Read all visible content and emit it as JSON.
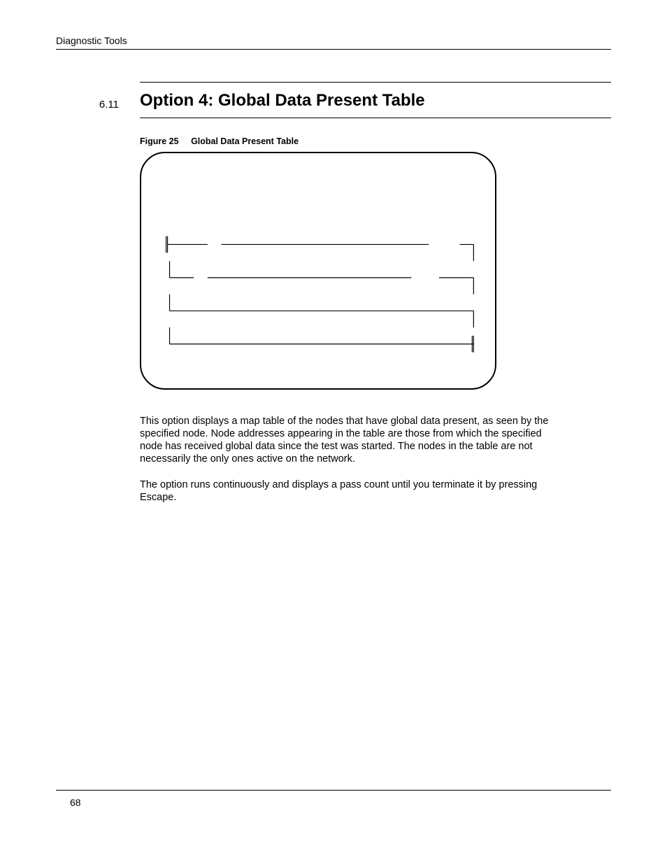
{
  "header": {
    "title": "Diagnostic Tools"
  },
  "section": {
    "number": "6.11",
    "heading": "Option 4:  Global Data Present Table"
  },
  "figure": {
    "label": "Figure 25",
    "title": "Global Data Present Table"
  },
  "body": {
    "p1": "This option displays a map table of the nodes that have global data present, as seen by the specified node.  Node addresses appearing in the table are those from which the specified node has received global data since the test was started. The nodes in the table are not necessarily the only ones active on the network.",
    "p2": "The option runs continuously and displays a pass count until you terminate it by pressing Escape."
  },
  "page_number": "68"
}
